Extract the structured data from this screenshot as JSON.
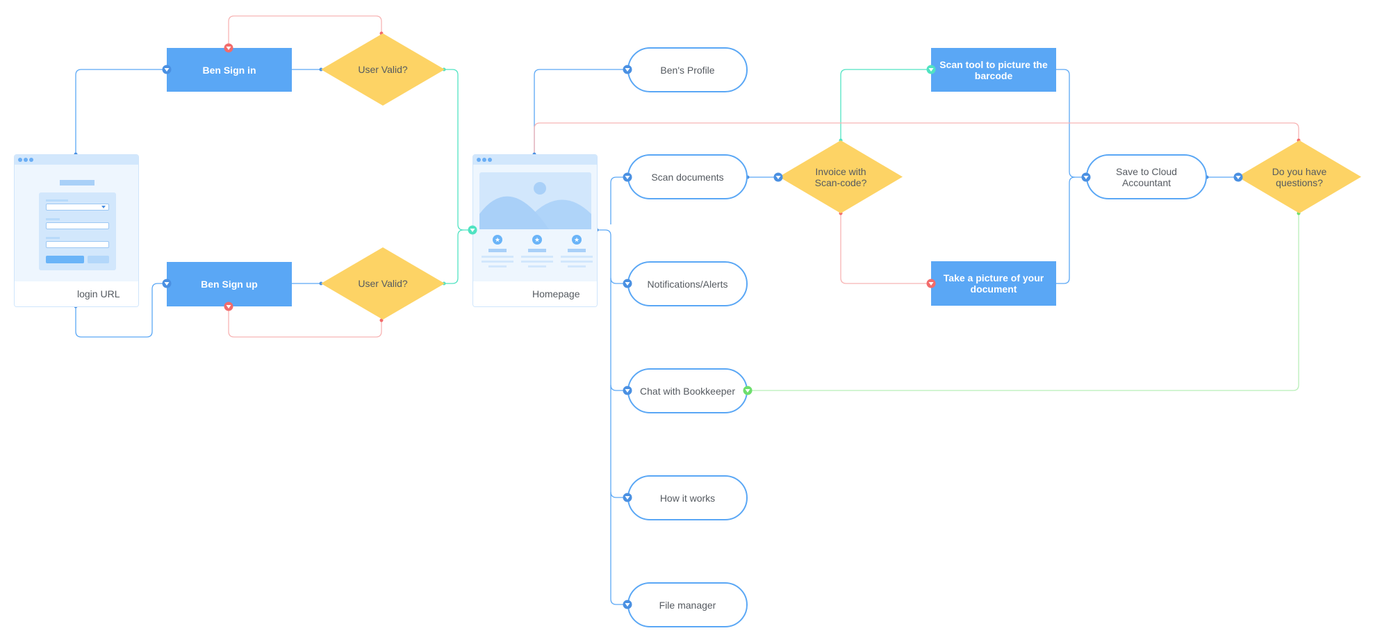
{
  "colors": {
    "process_fill": "#5aa7f5",
    "decision_fill": "#fdd365",
    "flow_blue": "#5aa7f5",
    "yes_green": "#50e3c2",
    "no_red": "#f26b6b",
    "chat_green": "#6dde6d"
  },
  "nodes": {
    "login": {
      "label": "login URL",
      "type": "webpage-mockup"
    },
    "sign_in": {
      "label": "Ben Sign in",
      "type": "process"
    },
    "sign_up": {
      "label": "Ben Sign up",
      "type": "process"
    },
    "valid_in": {
      "label": "User Valid?",
      "type": "decision"
    },
    "valid_up": {
      "label": "User Valid?",
      "type": "decision"
    },
    "homepage": {
      "label": "Homepage",
      "type": "webpage-mockup"
    },
    "profile": {
      "label": "Ben's Profile",
      "type": "terminal"
    },
    "scan_docs": {
      "label": "Scan documents",
      "type": "terminal"
    },
    "notifications": {
      "label": "Notifications/Alerts",
      "type": "terminal"
    },
    "chat": {
      "label": "Chat with Bookkeeper",
      "type": "terminal"
    },
    "how": {
      "label": "How it works",
      "type": "terminal"
    },
    "files": {
      "label": "File manager",
      "type": "terminal"
    },
    "invoice": {
      "label": "Invoice with Scan-code?",
      "type": "decision"
    },
    "scan_tool": {
      "label": "Scan tool to picture the barcode",
      "type": "process"
    },
    "take_picture": {
      "label": "Take a picture of your document",
      "type": "process"
    },
    "save_cloud": {
      "label": "Save to Cloud Accountant",
      "type": "terminal"
    },
    "questions": {
      "label": "Do you have questions?",
      "type": "decision"
    }
  },
  "edges": [
    {
      "from": "login",
      "to": "sign_in",
      "kind": "flow"
    },
    {
      "from": "login",
      "to": "sign_up",
      "kind": "flow"
    },
    {
      "from": "sign_in",
      "to": "valid_in",
      "kind": "flow"
    },
    {
      "from": "sign_up",
      "to": "valid_up",
      "kind": "flow"
    },
    {
      "from": "valid_in",
      "to": "sign_in",
      "kind": "no"
    },
    {
      "from": "valid_up",
      "to": "sign_up",
      "kind": "no"
    },
    {
      "from": "valid_in",
      "to": "homepage",
      "kind": "yes"
    },
    {
      "from": "valid_up",
      "to": "homepage",
      "kind": "yes"
    },
    {
      "from": "homepage",
      "to": "profile",
      "kind": "flow"
    },
    {
      "from": "homepage",
      "to": "scan_docs",
      "kind": "flow"
    },
    {
      "from": "homepage",
      "to": "notifications",
      "kind": "flow"
    },
    {
      "from": "homepage",
      "to": "chat",
      "kind": "flow"
    },
    {
      "from": "homepage",
      "to": "how",
      "kind": "flow"
    },
    {
      "from": "homepage",
      "to": "files",
      "kind": "flow"
    },
    {
      "from": "scan_docs",
      "to": "invoice",
      "kind": "flow"
    },
    {
      "from": "invoice",
      "to": "scan_tool",
      "kind": "yes"
    },
    {
      "from": "invoice",
      "to": "take_picture",
      "kind": "no"
    },
    {
      "from": "scan_tool",
      "to": "save_cloud",
      "kind": "flow"
    },
    {
      "from": "take_picture",
      "to": "save_cloud",
      "kind": "flow"
    },
    {
      "from": "save_cloud",
      "to": "questions",
      "kind": "flow"
    },
    {
      "from": "questions",
      "to": "homepage",
      "kind": "no"
    },
    {
      "from": "questions",
      "to": "chat",
      "kind": "yes"
    }
  ]
}
